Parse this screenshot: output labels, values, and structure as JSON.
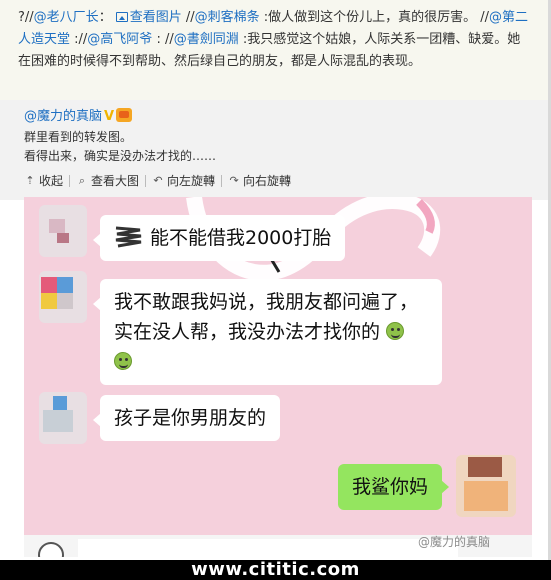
{
  "repost": {
    "prefix": "?//",
    "user1": "@老八厂长",
    "colon1": "：",
    "view_image": "查看图片",
    "slashes2": " //",
    "user2": "@刺客棉条",
    "text2": " :做人做到这个份儿上，真的很厉害。 //",
    "user3": "@第二人造天堂",
    "slashes3": " ://",
    "user4": "@高飞阿爷",
    "slashes4": " : //",
    "user5": "@書劍同淵",
    "text5": " :我只感觉这个姑娘，人际关系一团糟、缺爱。她在困难的时候得不到帮助、然后绿自己的朋友，都是人际混乱的表现。"
  },
  "original": {
    "author": "@魔力的真脑",
    "badge_v": "V",
    "line1": "群里看到的转发图。",
    "line2": "看得出来，确实是没办法才找的……"
  },
  "toolbar": {
    "collapse": "收起",
    "view_large": "查看大图",
    "rotate_left": "向左旋轉",
    "rotate_right": "向右旋轉"
  },
  "chat": {
    "msg1": "能不能借我2000打胎",
    "msg2_line1": "我不敢跟我妈说，我朋友都问遍了，",
    "msg2_line2": "实在没人帮，我没办法才找你的",
    "msg3": "孩子是你男朋友的",
    "msg4": "我鲨你妈"
  },
  "watermark": "@魔力的真脑",
  "footer": "www.cititic.com",
  "colors": {
    "link": "#1e6fc2",
    "chat_bg": "#f5d0dc",
    "my_bubble": "#94e55f",
    "footer_bg": "#000000"
  }
}
